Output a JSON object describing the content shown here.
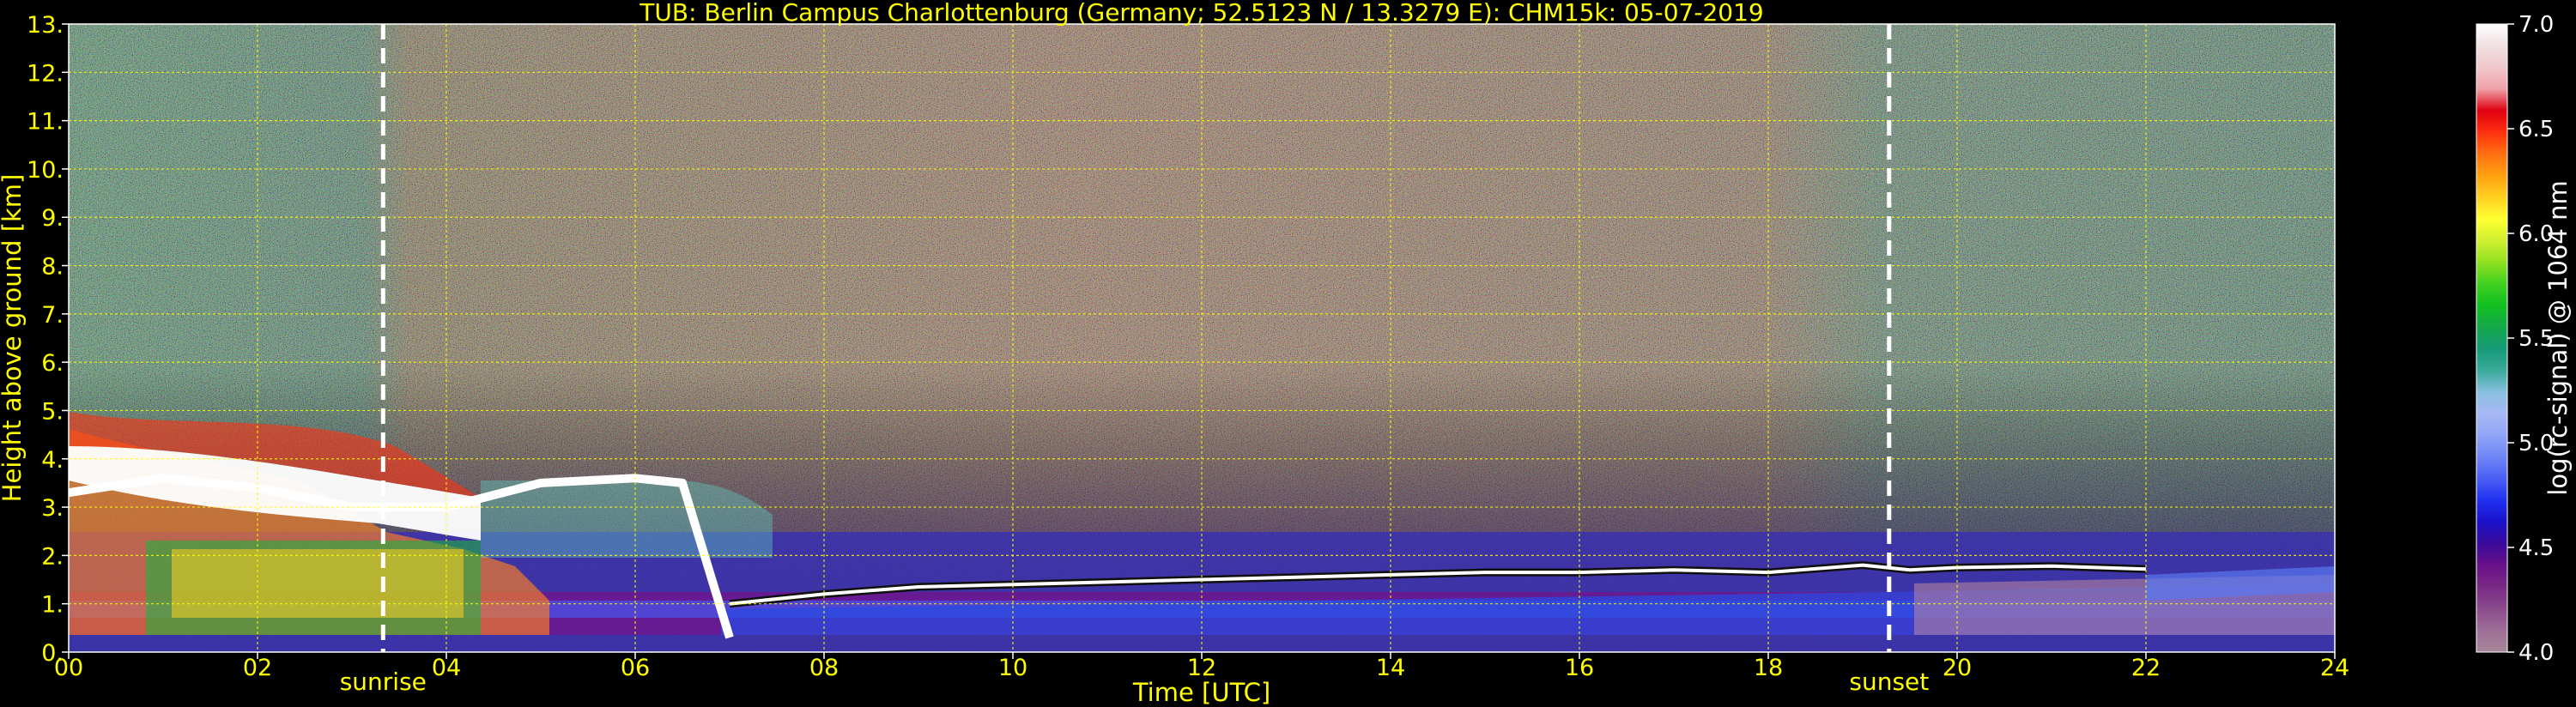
{
  "chart_data": {
    "type": "heatmap",
    "title": "TUB: Berlin Campus Charlottenburg (Germany; 52.5123 N / 13.3279 E):    CHM15k: 05-07-2019",
    "xlabel": "Time [UTC]",
    "ylabel": "Height above ground [km]",
    "xlim": [
      0,
      24
    ],
    "ylim": [
      0,
      13
    ],
    "x_ticks": [
      "00",
      "02",
      "04",
      "06",
      "08",
      "10",
      "12",
      "14",
      "16",
      "18",
      "20",
      "22",
      "24"
    ],
    "y_ticks": [
      "0.",
      "1.",
      "2.",
      "3.",
      "4.",
      "5.",
      "6.",
      "7.",
      "8.",
      "9.",
      "10.",
      "11.",
      "12.",
      "13."
    ],
    "grid": true,
    "events": [
      {
        "name": "sunrise",
        "time_utc": 3.33
      },
      {
        "name": "sunset",
        "time_utc": 19.28
      }
    ],
    "colorbar": {
      "label": "log(rc-signal) @ 1064 nm",
      "range": [
        4.0,
        7.0
      ],
      "ticks": [
        "4.0",
        "4.5",
        "5.0",
        "5.5",
        "6.0",
        "6.5",
        "7.0"
      ],
      "colors": [
        "#a8889a",
        "#9e6e96",
        "#8a4a8c",
        "#7a2a86",
        "#68108a",
        "#3a0a9a",
        "#1a10c8",
        "#2030f0",
        "#4a5ef5",
        "#6f86f6",
        "#8fa4f6",
        "#a8b8f4",
        "#88c0e0",
        "#3aaa9a",
        "#169a78",
        "#14a84a",
        "#10c020",
        "#40d020",
        "#90e020",
        "#d0f030",
        "#ffff30",
        "#ffd020",
        "#ffa010",
        "#ff7010",
        "#ff3010",
        "#e00010",
        "#f0a0a8",
        "#f0c8cc",
        "#f0e0e2",
        "#ffffff"
      ]
    },
    "cloud_base_height": {
      "x": [
        7.0,
        8.0,
        9.0,
        10.0,
        11.0,
        12.0,
        13.0,
        14.0,
        15.0,
        16.0,
        17.0,
        18.0,
        19.0,
        19.5,
        20.0,
        21.0,
        22.0
      ],
      "y": [
        1.0,
        1.2,
        1.35,
        1.4,
        1.45,
        1.5,
        1.55,
        1.6,
        1.65,
        1.65,
        1.7,
        1.65,
        1.8,
        1.7,
        1.75,
        1.78,
        1.72
      ]
    },
    "boundary_layer_top": {
      "x": [
        0,
        1,
        2,
        3,
        4,
        5,
        6,
        6.5,
        7.0
      ],
      "y": [
        3.3,
        3.6,
        3.4,
        3.0,
        3.0,
        3.5,
        3.6,
        3.5,
        0.3
      ]
    }
  }
}
